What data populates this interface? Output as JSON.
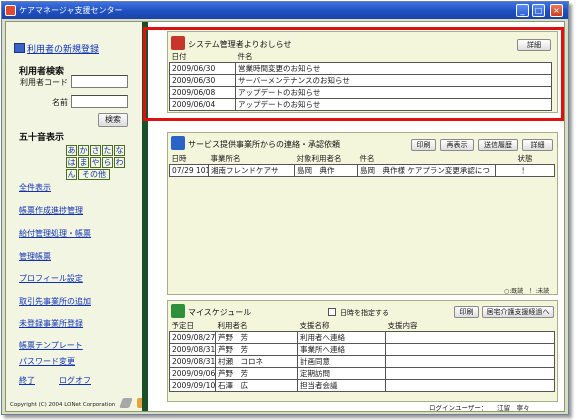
{
  "window": {
    "title": "ケアマネージャ支援センター",
    "minimize": "_",
    "maximize": "□",
    "close": "×"
  },
  "sidebar": {
    "register_link": "利用者の新規登録",
    "search_heading": "利用者検索",
    "code_label": "利用者コード",
    "code_value": "",
    "name_label": "名前",
    "name_value": "",
    "search_button": "検索",
    "kana_heading": "五十音表示",
    "kana_rows": [
      [
        "あ",
        "か",
        "さ",
        "た",
        "な"
      ],
      [
        "は",
        "ま",
        "や",
        "ら",
        "わ"
      ]
    ],
    "kana_last": [
      "ん",
      "その他"
    ],
    "show_all": "全件表示",
    "menu": [
      "帳票作成進捗管理",
      "給付管理処理・帳票",
      "管理帳票",
      "プロフィール設定",
      "取引先事業所の追加",
      "未登録事業所登録",
      "帳票テンプレート",
      "パスワード変更"
    ],
    "exit": "終了",
    "logoff": "ログオフ",
    "copyright": "Copyright (C) 2004 LONet Corporation"
  },
  "notice_panel": {
    "title": "システム管理者よりおしらせ",
    "detail_button": "詳細",
    "columns": [
      "日付",
      "件名"
    ],
    "rows": [
      [
        "2009/06/30",
        "営業時間変更のお知らせ"
      ],
      [
        "2009/06/30",
        "サーバーメンテナンスのお知らせ"
      ],
      [
        "2009/06/08",
        "アップデートのお知らせ"
      ],
      [
        "2009/06/04",
        "アップデートのお知らせ"
      ]
    ]
  },
  "service_panel": {
    "title": "サービス提供事業所からの連絡・承認依頼",
    "buttons": [
      "印刷",
      "再表示",
      "送信履歴",
      "詳細"
    ],
    "columns": [
      "日時",
      "事業所名",
      "対象利用者名",
      "件名",
      "状態"
    ],
    "rows": [
      [
        "07/29 1019",
        "湘南フレンドケアサ",
        "島岡　典作",
        "島岡　典作様 ケアプラン変更承認につ",
        "！"
      ]
    ],
    "legend": "○:既読　！:未読"
  },
  "schedule_panel": {
    "title": "マイスケジュール",
    "checkbox_label": "日時を指定する",
    "buttons": [
      "印刷",
      "居宅介護支援経過へ"
    ],
    "columns": [
      "予定日",
      "利用者名",
      "支援名称",
      "支援内容"
    ],
    "rows": [
      [
        "2009/08/27",
        "芦野　芳",
        "利用者へ連絡",
        ""
      ],
      [
        "2009/08/31",
        "芦野　芳",
        "事業所へ連絡",
        ""
      ],
      [
        "2009/08/31",
        "村瀬　コロネ",
        "計画同意",
        ""
      ],
      [
        "2009/09/06",
        "芦野　芳",
        "定期訪問",
        ""
      ],
      [
        "2009/09/10",
        "石澤　広",
        "担当者会議",
        ""
      ]
    ]
  },
  "footer": {
    "login_user": "ログインユーザー：　　江留　寧々"
  },
  "colors": {
    "sidebar_rail": "#1b4f2a",
    "panel_bg": "#f4f6dc",
    "highlight": "#e01010",
    "link": "#1033b5"
  }
}
